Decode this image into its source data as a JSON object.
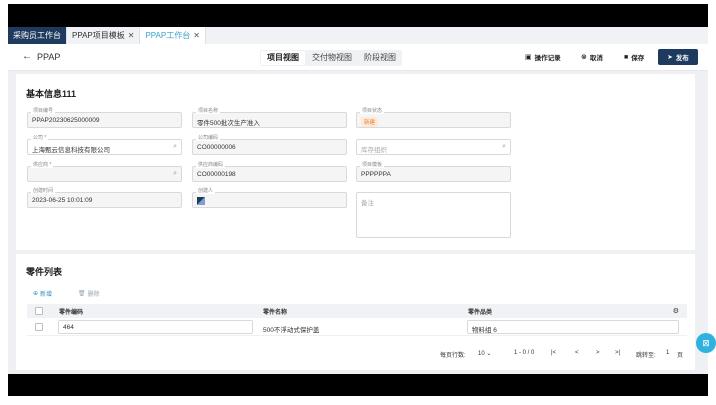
{
  "tabs": [
    {
      "label": "采购员工作台",
      "closable": false
    },
    {
      "label": "PPAP项目模板",
      "closable": true
    },
    {
      "label": "PPAP工作台",
      "closable": true
    }
  ],
  "header": {
    "back_icon": "arrow-left",
    "title": "PPAP",
    "views": [
      "项目视图",
      "交付物视图",
      "阶段视图"
    ],
    "active_view": "项目视图",
    "actions": {
      "log": "操作记录",
      "cancel": "取消",
      "save": "保存",
      "publish": "发布"
    }
  },
  "basic_info": {
    "title": "基本信息111",
    "fields": {
      "project_no": {
        "label": "项目编号",
        "value": "PPAP20230625000009"
      },
      "project_name": {
        "label": "项目名称",
        "value": "零件500批次生产准入"
      },
      "project_status": {
        "label": "项目状态",
        "value": "新建"
      },
      "company": {
        "label": "公司 *",
        "value": "上海甄云信息科技有限公司"
      },
      "company_code": {
        "label": "公司编码",
        "value": "CO00000006"
      },
      "inventory_org": {
        "label": "",
        "placeholder": "库存组织"
      },
      "supplier": {
        "label": "供应商 *",
        "value": ""
      },
      "supplier_code": {
        "label": "供应商编码",
        "value": "CO00000198"
      },
      "project_template": {
        "label": "项目模板",
        "value": "PPPPPPA"
      },
      "created_time": {
        "label": "创建时间",
        "value": "2023-06-25 10:01:09"
      },
      "creator": {
        "label": "创建人",
        "value": ""
      },
      "remark": {
        "label": "",
        "placeholder": "备注"
      }
    }
  },
  "parts": {
    "title": "零件列表",
    "toolbar": {
      "add": "新增",
      "delete": "删除"
    },
    "columns": [
      "零件编码",
      "零件名称",
      "零件品类"
    ],
    "rows": [
      {
        "code": "464",
        "name": "500不浮动式保护盖",
        "category": "物料组 6"
      }
    ]
  },
  "pagination": {
    "per_page_label": "每页行数:",
    "per_page": "10",
    "range": "1 - 0 / 0",
    "jump_label": "跳转至:",
    "jump_value": "1",
    "page_unit": "页"
  },
  "colors": {
    "primary_dark": "#1f3a5f",
    "accent_blue": "#3aa0c8",
    "status_orange": "#e8823a"
  }
}
